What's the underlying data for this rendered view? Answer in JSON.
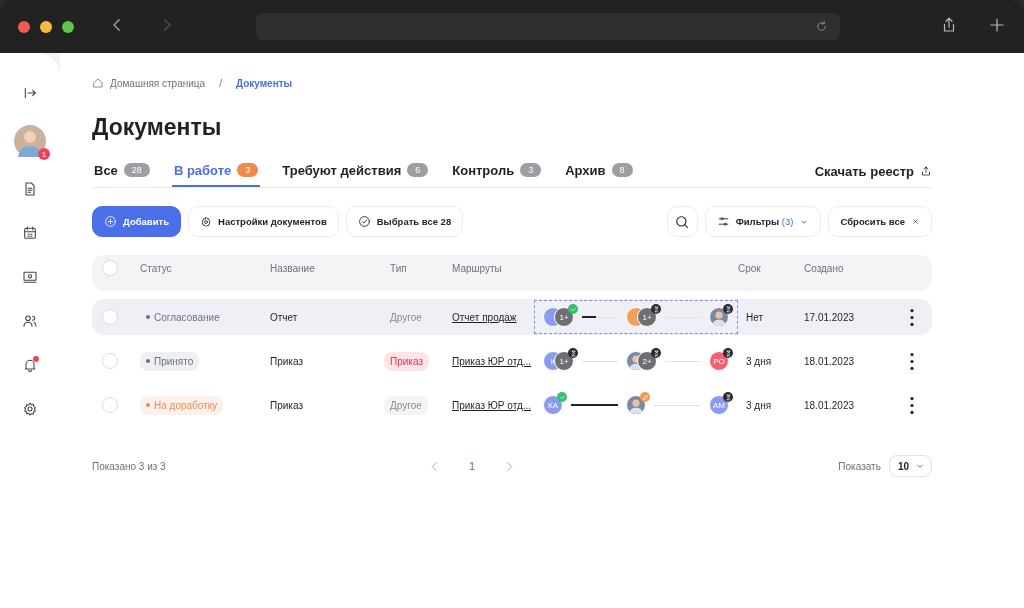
{
  "sidebar": {
    "items": [
      {
        "kind": "collapse"
      },
      {
        "kind": "avatar",
        "badge": "1"
      },
      {
        "kind": "document"
      },
      {
        "kind": "calendar"
      },
      {
        "kind": "money"
      },
      {
        "kind": "users"
      },
      {
        "kind": "bell",
        "dot": true
      },
      {
        "kind": "settings"
      }
    ]
  },
  "breadcrumbs": [
    "Домашняя страница",
    "/",
    "Документы"
  ],
  "title": "Документы",
  "tabs": [
    {
      "label": "Все",
      "count": "28",
      "selected": false
    },
    {
      "label": "В работе",
      "count": "3",
      "selected": true
    },
    {
      "label": "Требуют действия",
      "count": "6",
      "selected": false
    },
    {
      "label": "Контроль",
      "count": "3",
      "selected": false
    },
    {
      "label": "Архив",
      "count": "8",
      "selected": false
    }
  ],
  "download": "Скачать реестр",
  "toolbar": {
    "add": "Добавить",
    "settings": "Настройки документов",
    "select_all": "Выбрать все 28",
    "filters": "Фильтры",
    "filters_count": "(3)",
    "reset": "Сбросить все"
  },
  "table": {
    "checked": false,
    "columns": [
      "Статус",
      "Название",
      "Тип",
      "Маршруты",
      "Срок",
      "Создано"
    ],
    "rows": [
      {
        "checked": false,
        "highlighted": true,
        "status": {
          "text": "Согласование",
          "color": "#6b7280",
          "kind": "plain"
        },
        "name": "Отчет",
        "type": {
          "text": "Другое",
          "kind": "neutral"
        },
        "route": "Отчет продаж",
        "route_selected": true,
        "stages": [
          {
            "avatars": [
              {
                "kind": "initials",
                "color": "#8b9cf0"
              },
              {
                "kind": "more",
                "text": "1+"
              }
            ],
            "kind": "done"
          },
          {
            "avatars": [
              {
                "kind": "initials",
                "color": "#f59e5b"
              },
              {
                "kind": "more",
                "text": "1+"
              }
            ],
            "kind": "waiting"
          },
          {
            "avatars": [
              {
                "kind": "photo"
              }
            ],
            "kind": "waiting"
          }
        ],
        "connectors": [
          {
            "level": 0.4
          },
          {
            "level": 0
          }
        ],
        "term": "Нет",
        "created": "17.01.2023"
      },
      {
        "checked": false,
        "highlighted": false,
        "status": {
          "text": "Принято",
          "color": "#6b7280",
          "kind": "pill"
        },
        "name": "Приказ",
        "type": {
          "text": "Приказ",
          "kind": "alert"
        },
        "route": "Приказ ЮР отд...",
        "route_selected": false,
        "stages": [
          {
            "avatars": [
              {
                "kind": "initials",
                "color": "#8b9cf0",
                "text": "К"
              },
              {
                "kind": "more",
                "text": "1+"
              }
            ],
            "kind": "waiting"
          },
          {
            "avatars": [
              {
                "kind": "photo"
              },
              {
                "kind": "more",
                "text": "2+"
              }
            ],
            "kind": "waiting"
          },
          {
            "avatars": [
              {
                "kind": "initials",
                "color": "#f06272",
                "text": "РО"
              }
            ],
            "kind": "waiting"
          }
        ],
        "connectors": [
          {
            "level": 0
          },
          {
            "level": 0
          }
        ],
        "term": "3 дня",
        "created": "18.01.2023"
      },
      {
        "checked": false,
        "highlighted": false,
        "status": {
          "text": "На доработку",
          "color": "#f08a4b",
          "kind": "pill"
        },
        "name": "Приказ",
        "type": {
          "text": "Другое",
          "kind": "neutral"
        },
        "route": "Приказ ЮР отд...",
        "route_selected": false,
        "stages": [
          {
            "avatars": [
              {
                "kind": "initials",
                "color": "#8b9cf0",
                "text": "КА"
              }
            ],
            "kind": "done"
          },
          {
            "avatars": [
              {
                "kind": "photo"
              }
            ],
            "kind": "editing"
          },
          {
            "avatars": [
              {
                "kind": "initials",
                "color": "#8b9cf0",
                "text": "АМ"
              }
            ],
            "kind": "waiting"
          }
        ],
        "connectors": [
          {
            "level": 1
          },
          {
            "level": 0
          }
        ],
        "term": "3 дня",
        "created": "18.01.2023"
      }
    ]
  },
  "footer": {
    "shown": "Показано 3 из 3",
    "pages": [
      {
        "label": "1",
        "selected": true
      }
    ],
    "per_page_label": "Показать",
    "per_page": "10"
  }
}
